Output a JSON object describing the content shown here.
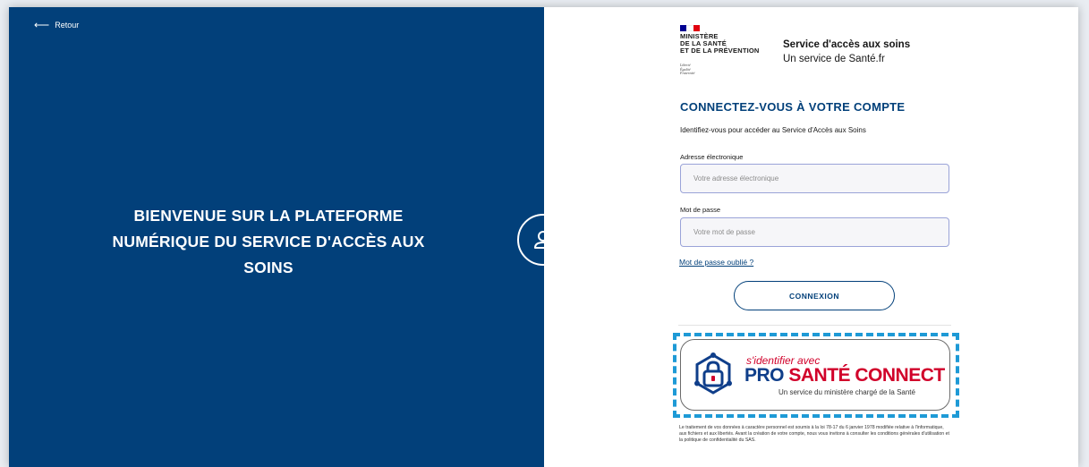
{
  "left": {
    "back_label": "Retour",
    "welcome_title": "BIENVENUE SUR LA PLATEFORME NUMÉRIQUE DU SERVICE D'ACCÈS AUX SOINS"
  },
  "branding": {
    "ministry_lines": [
      "MINISTÈRE",
      "DE LA SANTÉ",
      "ET DE LA PRÉVENTION"
    ],
    "motto_lines": [
      "Liberté",
      "Égalité",
      "Fraternité"
    ],
    "service_title": "Service d'accès aux soins",
    "service_subtitle": "Un service de Santé.fr",
    "flag_colors": [
      "#000091",
      "#ffffff",
      "#e1000f"
    ]
  },
  "login": {
    "title": "CONNECTEZ-VOUS À VOTRE COMPTE",
    "intro": "Identifiez-vous pour accéder au Service d'Accès aux Soins",
    "email_label": "Adresse électronique",
    "email_placeholder": "Votre adresse électronique",
    "email_value": "",
    "password_label": "Mot de passe",
    "password_placeholder": "Votre mot de passe",
    "password_value": "",
    "forgot_link": "Mot de passe oublié ?",
    "connect_button": "CONNEXION"
  },
  "psc": {
    "line1": "s'identifier avec",
    "brand_pro": "PRO",
    "brand_sante": "SANTÉ",
    "brand_connect": "CONNECT",
    "tagline": "Un service du ministère chargé de la Santé"
  },
  "legal_text": "Le traitement de vos données à caractère personnel est soumis à la loi 78-17 du 6 janvier 1978 modifiée relative à l'informatique, aux fichiers et aux libertés. Avant la création de votre compte, nous vous invitons à consulter les conditions générales d'utilisation et la politique de confidentialité du SAS.",
  "colors": {
    "primary_blue": "#02407a",
    "psc_red": "#d1002a",
    "psc_navy": "#0f3e8a",
    "highlight_blue": "#1e9ad6"
  },
  "icons": [
    "arrow-left-icon",
    "user-icon",
    "psc-lock-icon"
  ]
}
